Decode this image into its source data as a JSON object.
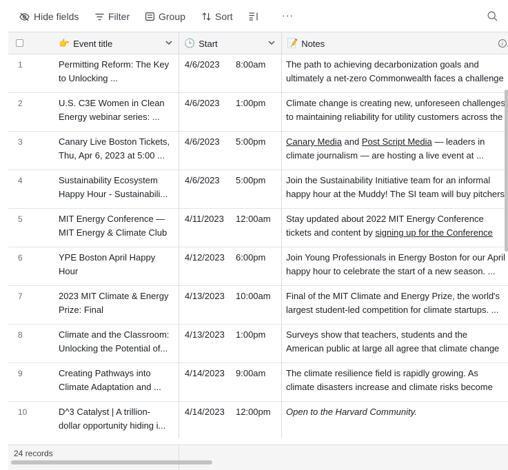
{
  "toolbar": {
    "hide_fields": "Hide fields",
    "filter": "Filter",
    "group": "Group",
    "sort": "Sort",
    "more": "···"
  },
  "columns": {
    "title": {
      "emoji": "👉",
      "label": "Event title"
    },
    "start": {
      "emoji": "🕒",
      "label": "Start"
    },
    "notes": {
      "emoji": "📝",
      "label": "Notes"
    }
  },
  "rows": [
    {
      "num": "1",
      "title": "Permitting Reform: The Key\nto Unlocking ...",
      "date": "4/6/2023",
      "time": "8:00am",
      "notes": [
        [
          "The path to achieving decarbonization goals and"
        ],
        [
          "ultimately a net-zero Commonwealth faces a challenge"
        ]
      ]
    },
    {
      "num": "2",
      "title": "U.S. C3E Women in Clean\nEnergy webinar series: ...",
      "date": "4/6/2023",
      "time": "1:00pm",
      "notes": [
        [
          "Climate change is creating new, unforeseen challenges"
        ],
        [
          "to maintaining reliability for utility customers across the"
        ]
      ]
    },
    {
      "num": "3",
      "title": "Canary Live Boston Tickets,\nThu, Apr 6, 2023 at 5:00 ...",
      "date": "4/6/2023",
      "time": "5:00pm",
      "notes": [
        [
          "Canary Media",
          " and ",
          "Post Script Media",
          " — leaders in"
        ],
        [
          "climate journalism — are hosting a live event at ..."
        ]
      ],
      "notes_links": [
        0,
        2
      ]
    },
    {
      "num": "4",
      "title": "Sustainability Ecosystem\nHappy Hour - Sustainabili...",
      "date": "4/6/2023",
      "time": "5:00pm",
      "notes": [
        [
          "Join the Sustainability Initiative team for an informal"
        ],
        [
          "happy hour at the Muddy! The SI team will buy pitchers"
        ]
      ]
    },
    {
      "num": "5",
      "title": "MIT Energy Conference —\nMIT Energy & Climate Club",
      "date": "4/11/2023",
      "time": "12:00am",
      "notes": [
        [
          "Stay updated about 2022 MIT Energy Conference"
        ],
        [
          "tickets and content by ",
          "signing up for the Conference"
        ]
      ],
      "notes_links2": [
        1
      ]
    },
    {
      "num": "6",
      "title": "YPE Boston April Happy\nHour",
      "date": "4/12/2023",
      "time": "6:00pm",
      "notes": [
        [
          "Join Young Professionals in Energy Boston for our April"
        ],
        [
          "happy hour to celebrate the start of a new season. ..."
        ]
      ]
    },
    {
      "num": "7",
      "title": "2023 MIT Climate & Energy\nPrize: Final",
      "date": "4/13/2023",
      "time": "10:00am",
      "notes": [
        [
          "Final of the MIT Climate and Energy Prize, the world's"
        ],
        [
          "largest student-led competition for climate startups. ..."
        ]
      ]
    },
    {
      "num": "8",
      "title": "Climate and the Classroom:\nUnlocking the Potential of...",
      "date": "4/13/2023",
      "time": "1:00pm",
      "notes": [
        [
          "Surveys show that teachers, students and the"
        ],
        [
          "American public at large all agree that climate change"
        ]
      ]
    },
    {
      "num": "9",
      "title": "Creating Pathways into\nClimate Adaptation and ...",
      "date": "4/14/2023",
      "time": "9:00am",
      "notes": [
        [
          "The climate resilience field is rapidly growing. As"
        ],
        [
          "climate disasters increase and climate risks become"
        ]
      ]
    },
    {
      "num": "10",
      "title": "D^3 Catalyst | A trillion-\ndollar opportunity hiding i...",
      "date": "4/14/2023",
      "time": "12:00pm",
      "notes": [
        [
          "Open to the Harvard Community."
        ]
      ],
      "italic": true
    }
  ],
  "footer": {
    "records": "24 records"
  }
}
